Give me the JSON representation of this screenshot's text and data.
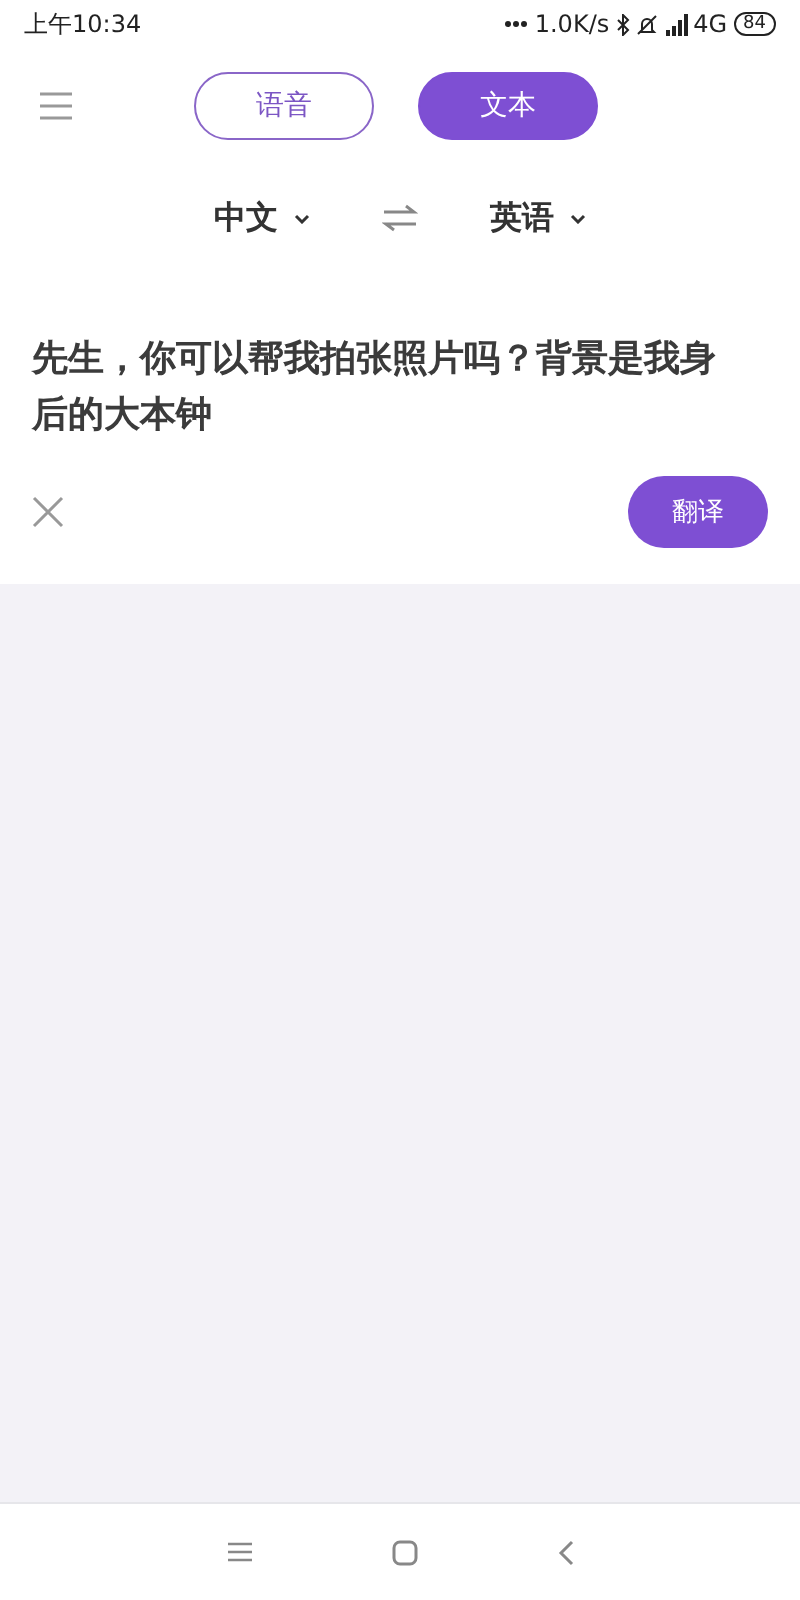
{
  "status_bar": {
    "time": "上午10:34",
    "speed": "1.0K/s",
    "network": "4G",
    "battery": "84"
  },
  "tabs": [
    {
      "label": "语音",
      "selected": false
    },
    {
      "label": "文本",
      "selected": true
    }
  ],
  "languages": {
    "source": "中文",
    "target": "英语"
  },
  "input": {
    "value": "先生，你可以帮我拍张照片吗？背景是我身后的大本钟"
  },
  "translate_button": "翻译"
}
